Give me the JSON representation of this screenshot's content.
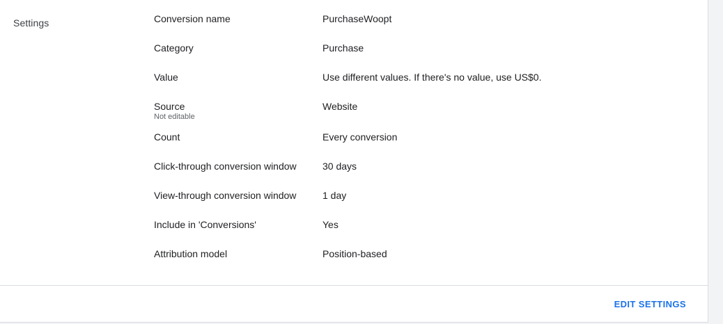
{
  "section": {
    "title": "Settings"
  },
  "settings": [
    {
      "label": "Conversion name",
      "value": "PurchaseWoopt"
    },
    {
      "label": "Category",
      "value": "Purchase"
    },
    {
      "label": "Value",
      "value": "Use different values. If there's no value, use US$0."
    },
    {
      "label": "Source",
      "sublabel": "Not editable",
      "value": "Website"
    },
    {
      "label": "Count",
      "value": "Every conversion"
    },
    {
      "label": "Click-through conversion window",
      "value": "30 days"
    },
    {
      "label": "View-through conversion window",
      "value": "1 day"
    },
    {
      "label": "Include in 'Conversions'",
      "value": "Yes"
    },
    {
      "label": "Attribution model",
      "value": "Position-based"
    }
  ],
  "footer": {
    "edit_label": "EDIT SETTINGS"
  },
  "colors": {
    "accent": "#1a73e8",
    "divider": "#dadce0",
    "background": "#f1f3f4"
  }
}
